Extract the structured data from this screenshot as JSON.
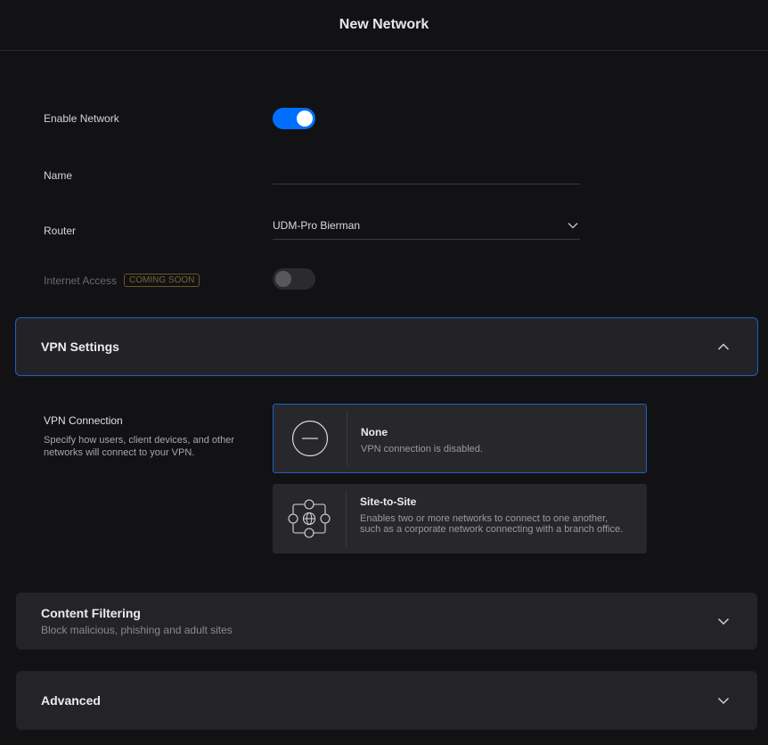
{
  "header": {
    "title": "New Network"
  },
  "form": {
    "enable_network": {
      "label": "Enable Network",
      "enabled": true
    },
    "name": {
      "label": "Name",
      "value": "",
      "placeholder": ""
    },
    "router": {
      "label": "Router",
      "value": "UDM-Pro Bierman"
    },
    "internet_access": {
      "label": "Internet Access",
      "badge": "COMING SOON",
      "enabled": false
    }
  },
  "vpn_settings": {
    "title": "VPN Settings",
    "expanded": true,
    "connection": {
      "label": "VPN Connection",
      "description": "Specify how users, client devices, and other networks will connect to your VPN.",
      "options": [
        {
          "title": "None",
          "description": "VPN connection is disabled.",
          "selected": true,
          "icon": "minus-circle-icon"
        },
        {
          "title": "Site-to-Site",
          "description": "Enables two or more networks to connect to one another, such as a corporate network connecting with a branch office.",
          "selected": false,
          "icon": "site-to-site-icon"
        }
      ]
    }
  },
  "content_filtering": {
    "title": "Content Filtering",
    "subtitle": "Block malicious, phishing and adult sites",
    "expanded": false
  },
  "advanced": {
    "title": "Advanced",
    "expanded": false
  },
  "colors": {
    "accent": "#006fff",
    "background": "#121215",
    "panel": "#242428",
    "badge": "#7a6330"
  }
}
